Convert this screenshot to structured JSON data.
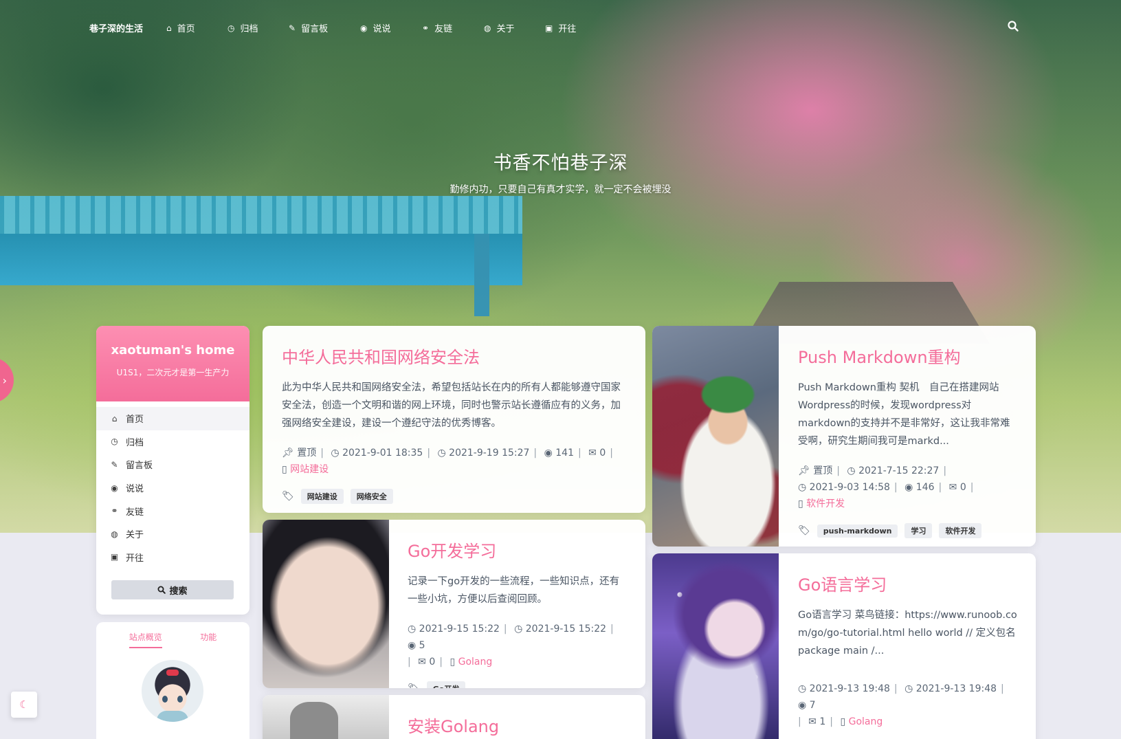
{
  "nav": {
    "brand": "巷子深的生活",
    "items": [
      {
        "label": "首页",
        "icon": "home-icon",
        "glyph": "⌂"
      },
      {
        "label": "归档",
        "icon": "clock-icon",
        "glyph": "◷"
      },
      {
        "label": "留言板",
        "icon": "comments-icon",
        "glyph": "✎"
      },
      {
        "label": "说说",
        "icon": "weibo-icon",
        "glyph": "◉"
      },
      {
        "label": "友链",
        "icon": "link-icon",
        "glyph": "⚭"
      },
      {
        "label": "关于",
        "icon": "user-circle-icon",
        "glyph": "◍"
      },
      {
        "label": "开往",
        "icon": "train-icon",
        "glyph": "▣"
      }
    ]
  },
  "hero": {
    "title": "书香不怕巷子深",
    "subtitle": "勤修内功，只要自己有真才实学，就一定不会被埋没"
  },
  "sidebar": {
    "title": "xaotuman's home",
    "desc": "U1S1，二次元才是第一生产力",
    "menu": [
      {
        "label": "首页",
        "icon": "home-icon",
        "glyph": "⌂"
      },
      {
        "label": "归档",
        "icon": "clock-icon",
        "glyph": "◷"
      },
      {
        "label": "留言板",
        "icon": "comments-icon",
        "glyph": "✎"
      },
      {
        "label": "说说",
        "icon": "weibo-icon",
        "glyph": "◉"
      },
      {
        "label": "友链",
        "icon": "link-icon",
        "glyph": "⚭"
      },
      {
        "label": "关于",
        "icon": "user-circle-icon",
        "glyph": "◍"
      },
      {
        "label": "开往",
        "icon": "train-icon",
        "glyph": "▣"
      }
    ],
    "search_label": "搜索"
  },
  "overview": {
    "tabs": [
      "站点概览",
      "功能"
    ]
  },
  "posts": [
    {
      "title": "中华人民共和国网络安全法",
      "excerpt": "此为中华人民共和国网络安全法，希望包括站长在内的所有人都能够遵守国家安全法，创造一个文明和谐的网上环境，同时也警示站长遵循应有的义务，加强网络安全建设，建设一个遵纪守法的优秀博客。",
      "pinned": "置顶",
      "created": "2021-9-01 18:35",
      "updated": "2021-9-19 15:27",
      "views": "141",
      "comments": "0",
      "category": "网站建设",
      "tags": [
        "网站建设",
        "网络安全"
      ]
    },
    {
      "title": "Push Markdown重构",
      "excerpt": "Push Markdown重构 契机　自己在搭建网站Wordpress的时候，发现wordpress对markdown的支持并不是非常好，这让我非常难受啊，研究生期间我可是markd...",
      "pinned": "置顶",
      "created": "2021-7-15 22:27",
      "updated": "2021-9-03 14:58",
      "views": "146",
      "comments": "0",
      "category": "软件开发",
      "tags": [
        "push-markdown",
        "学习",
        "软件开发"
      ]
    },
    {
      "title": "Go开发学习",
      "excerpt": "记录一下go开发的一些流程，一些知识点，还有一些小坑，方便以后查阅回顾。",
      "created": "2021-9-15 15:22",
      "updated": "2021-9-15 15:22",
      "views": "5",
      "comments": "0",
      "category": "Golang",
      "tags": [
        "Go开发"
      ]
    },
    {
      "title": "Go语言学习",
      "excerpt": "Go语言学习 菜鸟链接：https://www.runoob.com/go/go-tutorial.html hello world // 定义包名 package main /...",
      "created": "2021-9-13 19:48",
      "updated": "2021-9-13 19:48",
      "views": "7",
      "comments": "1",
      "category": "Golang"
    },
    {
      "title": "安装Golang"
    }
  ]
}
